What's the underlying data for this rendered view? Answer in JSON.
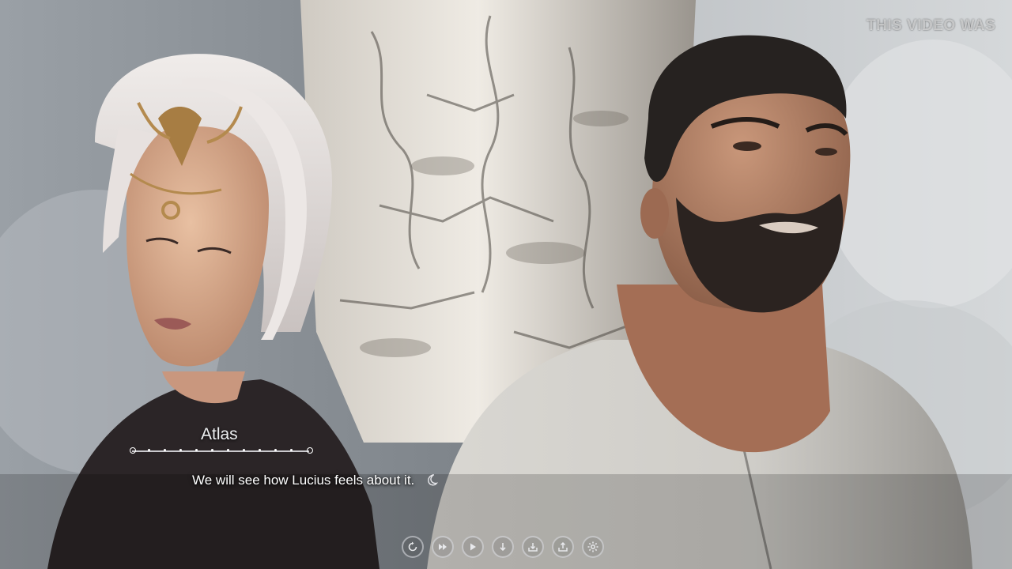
{
  "watermark": {
    "text": "THIS VIDEO WAS"
  },
  "dialogue": {
    "speaker": "Atlas",
    "line": "We will see how Lucius feels about it."
  },
  "quick_menu": {
    "buttons": [
      {
        "name": "rollback",
        "icon": "rollback-icon"
      },
      {
        "name": "skip",
        "icon": "skip-icon"
      },
      {
        "name": "auto",
        "icon": "play-icon"
      },
      {
        "name": "save",
        "icon": "arrow-down-icon"
      },
      {
        "name": "load",
        "icon": "tray-download-icon"
      },
      {
        "name": "export",
        "icon": "tray-upload-icon"
      },
      {
        "name": "settings",
        "icon": "gear-icon"
      }
    ]
  },
  "colors": {
    "text": "#ffffff",
    "name_rule": "#e6e6eb",
    "bark": "#e8e4de"
  }
}
